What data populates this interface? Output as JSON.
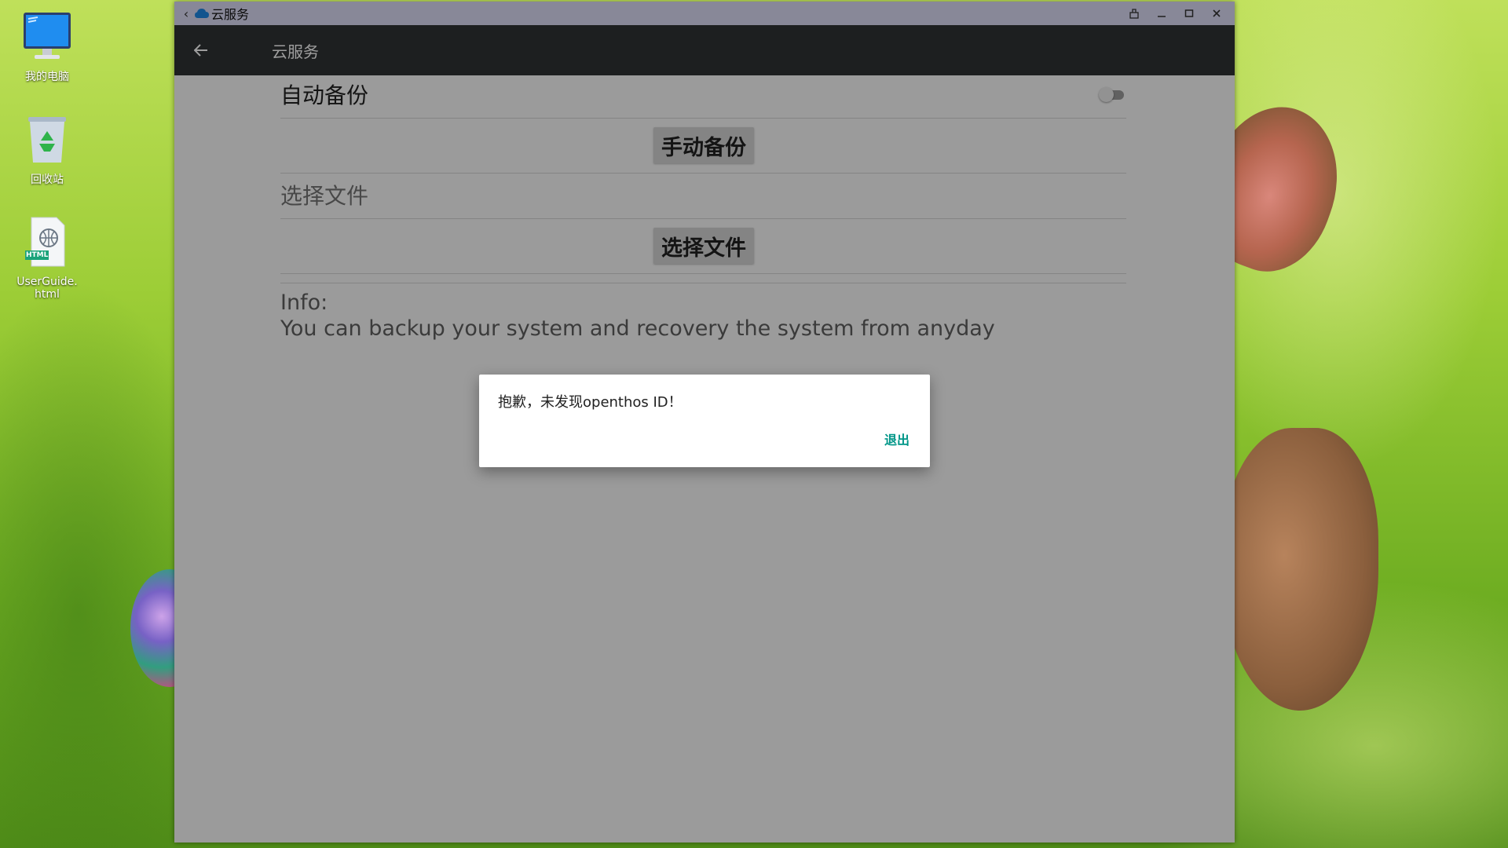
{
  "desktop": {
    "icons": [
      {
        "label": "我的电脑",
        "icon": "computer-icon"
      },
      {
        "label": "回收站",
        "icon": "recycle-bin-icon"
      },
      {
        "label": "UserGuide.html",
        "icon": "html-file-icon",
        "badge": "HTML"
      }
    ]
  },
  "window": {
    "title": "云服务",
    "title_icon": "cloud-icon",
    "controls": [
      "back-icon",
      "pin-icon",
      "minimize-icon",
      "maximize-icon",
      "close-icon"
    ],
    "titlebar_color": "#dcdcf5"
  },
  "appbar": {
    "title": "云服务",
    "back_icon": "arrow-left-icon",
    "color": "#303335"
  },
  "settings": {
    "auto_backup_label": "自动备份",
    "auto_backup_enabled": false,
    "manual_backup_button": "手动备份",
    "select_file_label": "选择文件",
    "select_file_button": "选择文件",
    "info_title": "Info:",
    "info_body": "You can backup your system and recovery the system from anyday"
  },
  "dialog": {
    "message": "抱歉，未发现openthos ID！",
    "button": "退出",
    "accent": "#009688"
  }
}
